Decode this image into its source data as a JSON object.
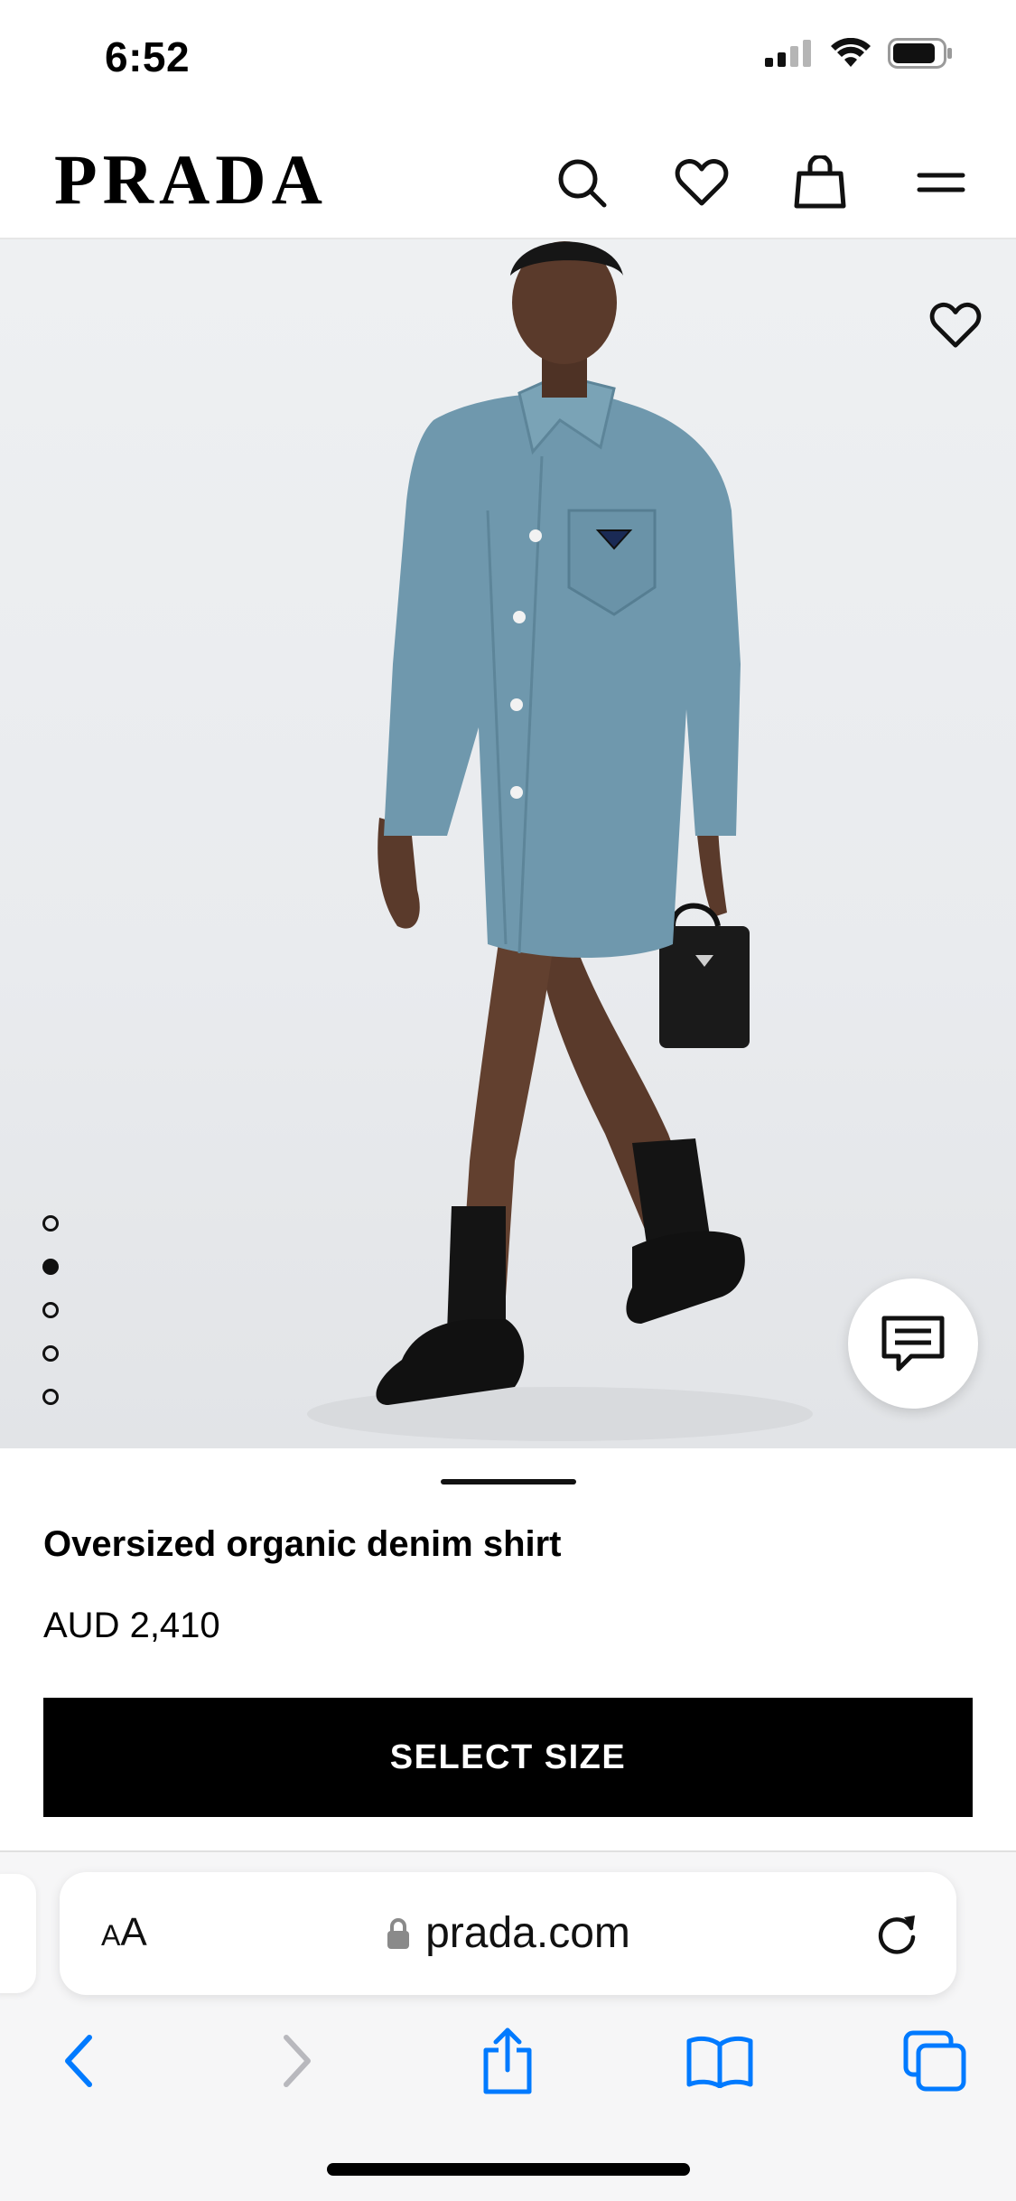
{
  "status_bar": {
    "time": "6:52"
  },
  "header": {
    "brand": "PRADA",
    "icons": [
      "search-icon",
      "heart-icon",
      "bag-icon",
      "menu-icon"
    ]
  },
  "gallery": {
    "image_count": 5,
    "active_index": 1
  },
  "product": {
    "name": "Oversized organic denim shirt",
    "price": "AUD 2,410",
    "cta_label": "SELECT SIZE"
  },
  "browser": {
    "text_size_label_small": "A",
    "text_size_label_large": "A",
    "url": "prada.com"
  },
  "colors": {
    "accent": "#007aff",
    "button": "#000000",
    "denim": "#6f98ad"
  }
}
